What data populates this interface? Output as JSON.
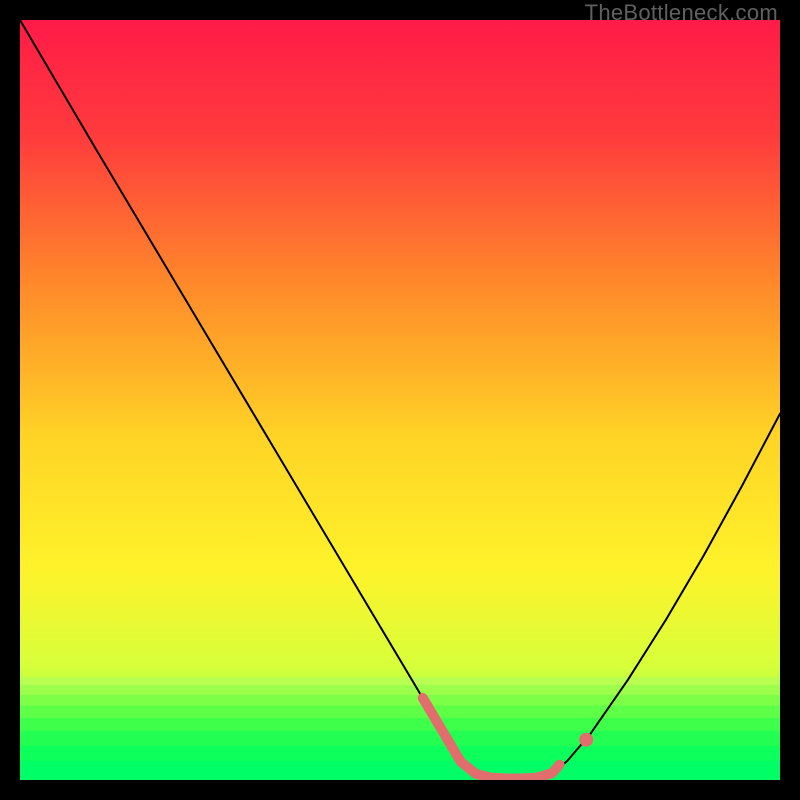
{
  "watermark": "TheBottleneck.com",
  "chart_data": {
    "type": "line",
    "title": "",
    "xlabel": "",
    "ylabel": "",
    "xlim": [
      0,
      100
    ],
    "ylim": [
      0,
      100
    ],
    "series": [
      {
        "name": "curve",
        "x": [
          0,
          5,
          10,
          15,
          20,
          25,
          30,
          35,
          40,
          45,
          50,
          55,
          58,
          60,
          62,
          64,
          66,
          68,
          70,
          72,
          75,
          80,
          85,
          90,
          95,
          100
        ],
        "values": [
          100,
          91.5,
          83.0,
          74.6,
          66.2,
          57.8,
          49.4,
          41.0,
          32.6,
          24.2,
          15.8,
          7.4,
          2.4,
          0.8,
          0.3,
          0.2,
          0.2,
          0.3,
          0.9,
          2.5,
          6.0,
          13.2,
          21.1,
          29.6,
          38.7,
          48.2
        ]
      },
      {
        "name": "highlight-segment",
        "x": [
          53,
          56,
          58,
          60,
          62,
          64,
          66,
          68,
          70,
          71
        ],
        "values": [
          10.8,
          5.75,
          2.4,
          0.8,
          0.3,
          0.2,
          0.2,
          0.3,
          0.9,
          2.0
        ]
      },
      {
        "name": "highlight-dot",
        "x": [
          74.5
        ],
        "values": [
          5.3
        ]
      }
    ],
    "gradient_stops": [
      {
        "offset": 0.0,
        "color": "#ff1b47"
      },
      {
        "offset": 0.15,
        "color": "#ff3a3d"
      },
      {
        "offset": 0.35,
        "color": "#ff8a2a"
      },
      {
        "offset": 0.55,
        "color": "#ffd426"
      },
      {
        "offset": 0.72,
        "color": "#fff22a"
      },
      {
        "offset": 0.85,
        "color": "#d7ff3a"
      },
      {
        "offset": 0.93,
        "color": "#8cff4a"
      },
      {
        "offset": 1.0,
        "color": "#00ff66"
      }
    ],
    "green_bands": [
      {
        "y0": 0.865,
        "y1": 0.875,
        "color": "#b8ff52"
      },
      {
        "y0": 0.875,
        "y1": 0.888,
        "color": "#9bff4c"
      },
      {
        "y0": 0.888,
        "y1": 0.902,
        "color": "#7dff48"
      },
      {
        "y0": 0.902,
        "y1": 0.918,
        "color": "#5dff47"
      },
      {
        "y0": 0.918,
        "y1": 0.935,
        "color": "#3eff4a"
      },
      {
        "y0": 0.935,
        "y1": 0.955,
        "color": "#22ff52"
      },
      {
        "y0": 0.955,
        "y1": 0.975,
        "color": "#0dff5c"
      },
      {
        "y0": 0.975,
        "y1": 1.0,
        "color": "#00ff66"
      }
    ],
    "styles": {
      "curve_stroke": "#000000",
      "curve_width": 2.0,
      "highlight_stroke": "#e26d6d",
      "highlight_width": 10,
      "highlight_dot_r": 7
    }
  }
}
